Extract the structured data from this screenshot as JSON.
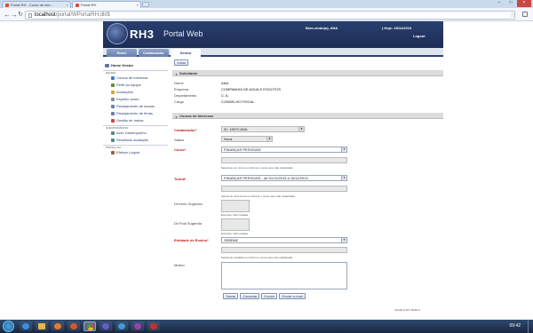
{
  "browser": {
    "tabs": [
      {
        "label": "Portal RH - Curso de inte…",
        "close": "×"
      },
      {
        "label": "Portal RH",
        "close": "×"
      }
    ],
    "window_controls": {
      "minimize": "–",
      "maximize": "□",
      "close": "×"
    },
    "url_host": "localhost",
    "url_path": "/portal/WPortalRH.dll/$"
  },
  "header": {
    "logo_text": "RH3",
    "logo_sub": "Portal Web",
    "welcome": "Bem-vindo(a), ANA",
    "date": "| Hoje: 28/11/2013",
    "logout": "Logout"
  },
  "nav": {
    "tabs": [
      "Home",
      "Colaborador",
      "Gestor"
    ],
    "active": "Gestor"
  },
  "sidebar": {
    "home": "Home Gestor",
    "sections": [
      {
        "title": "EQUIPE",
        "items": [
          "Cursos de interesse",
          "Perfil da equipe",
          "Anotações",
          "Espelho ponto",
          "Planejamento de escala",
          "Planejamento de férias",
          "Gestão de metas"
        ]
      },
      {
        "title": "QUESTIONÁRIOS",
        "items": [
          "Aval. Desempenho",
          "Resultado avaliação"
        ]
      },
      {
        "title": "PORTAL RH",
        "items": [
          "Efetuar Logout"
        ]
      }
    ]
  },
  "content": {
    "back_button": "Voltar",
    "solicitante": {
      "title": "Solicitante",
      "rows": [
        {
          "label": "Nome",
          "value": "ANA"
        },
        {
          "label": "Empresa",
          "value": "COMPANHIA DE AGUA E ESGOTOS"
        },
        {
          "label": "Departamento",
          "value": "C. A."
        },
        {
          "label": "Cargo",
          "value": "CONSELHO FISCAL"
        }
      ]
    },
    "cursos": {
      "title": "Cursos de Interesse",
      "colaborador_label": "Colaborador*",
      "colaborador_value": "ID: 18970  ANA",
      "status_label": "Status",
      "status_value": "Nova",
      "curso_label": "Curso*",
      "curso_value": "FINANÇAS PESSOAIS",
      "curso_hint": "Selecione um curso ou informe o nome caso não cadastrado",
      "turma_label": "Turma*",
      "turma_value": "FINANÇAS PESSOAIS -  de 01/11/2013 a 15/11/2013",
      "turma_hint": "Selecione uma turma ou informe o nome caso não cadastrada",
      "dt_inicio_label": "Dt.Inicio Sugerida",
      "dt_inicio_hint": "Exemplo: dd/mm/aaaa",
      "dt_final_label": "Dt.Final Sugerida",
      "dt_final_hint": "Exemplo: dd/mm/aaaa",
      "entidade_label": "Entidade de Ensino*",
      "entidade_value": "SEBRAE",
      "entidade_hint": "Selecione entidade ou informe o nome caso não cadastrada",
      "motivo_label": "Motivo",
      "dropdown_glyph": "▼"
    },
    "actions": [
      "Salvar",
      "Cancelar",
      "Excluir",
      "Enviar e-mail"
    ],
    "version": "Versão 6.10.1 Build 0"
  },
  "taskbar": {
    "time": "09:42"
  },
  "icons": [
    "favicon-icon",
    "back-icon",
    "forward-icon",
    "reload-icon",
    "star-icon",
    "wrench-icon",
    "start-icon"
  ],
  "colors": {
    "brand": "#2a3f6f",
    "required": "#c0181a",
    "section": "#dcdcdc"
  }
}
